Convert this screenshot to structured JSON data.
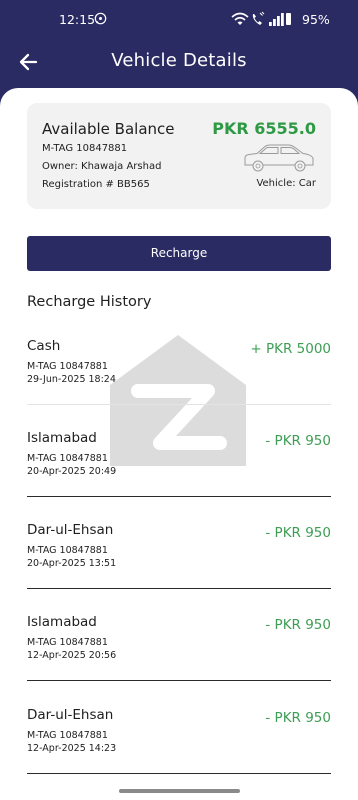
{
  "status_bar": {
    "time": "12:15",
    "battery": "95%"
  },
  "header": {
    "title": "Vehicle Details"
  },
  "balance_card": {
    "title": "Available Balance",
    "amount": "PKR 6555.0",
    "mtag": "M-TAG 10847881",
    "owner": "Owner: Khawaja Arshad",
    "registration": "Registration # BB565",
    "vehicle": "Vehicle: Car"
  },
  "recharge_button": {
    "label": "Recharge"
  },
  "history": {
    "title": "Recharge History",
    "items": [
      {
        "title": "Cash",
        "tag": "M-TAG 10847881",
        "date": "29-Jun-2025 18:24",
        "amount": "+ PKR 5000"
      },
      {
        "title": "Islamabad",
        "tag": "M-TAG 10847881",
        "date": "20-Apr-2025 20:49",
        "amount": "- PKR 950"
      },
      {
        "title": "Dar-ul-Ehsan",
        "tag": "M-TAG 10847881",
        "date": "20-Apr-2025 13:51",
        "amount": "- PKR 950"
      },
      {
        "title": "Islamabad",
        "tag": "M-TAG 10847881",
        "date": "12-Apr-2025 20:56",
        "amount": "- PKR 950"
      },
      {
        "title": "Dar-ul-Ehsan",
        "tag": "M-TAG 10847881",
        "date": "12-Apr-2025 14:23",
        "amount": "- PKR 950"
      }
    ]
  },
  "colors": {
    "primary": "#2b2b63",
    "positive": "#2e9a46",
    "card_bg": "#f2f2f2"
  },
  "icons": [
    "back-arrow-icon",
    "whatsapp-icon",
    "wifi-icon",
    "phone-icon",
    "signal-icon",
    "car-icon"
  ]
}
